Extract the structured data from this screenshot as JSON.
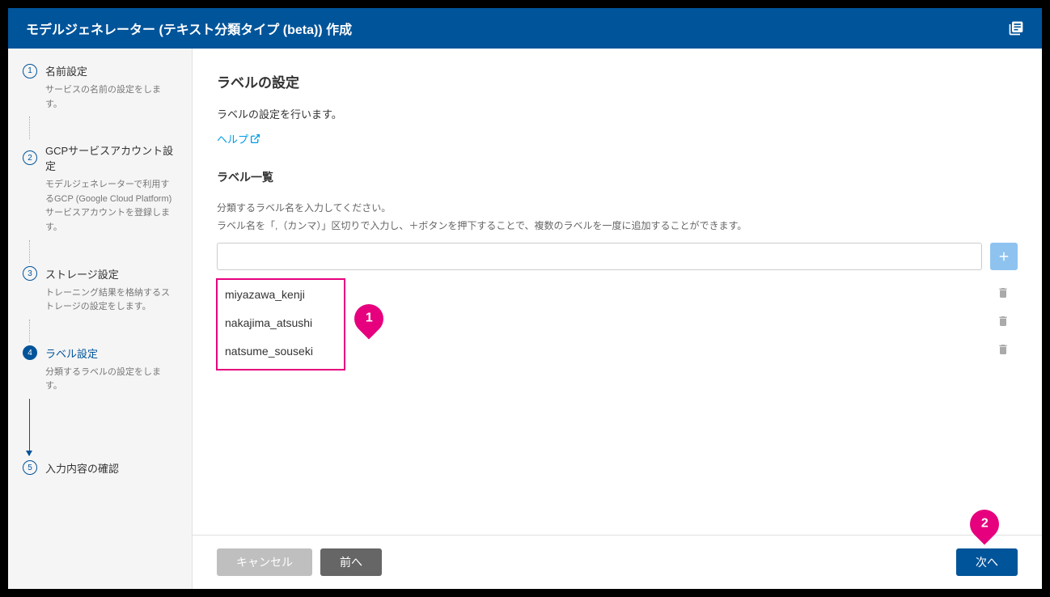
{
  "header": {
    "title": "モデルジェネレーター (テキスト分類タイプ (beta)) 作成"
  },
  "sidebar": {
    "steps": [
      {
        "num": "1",
        "title": "名前設定",
        "desc": "サービスの名前の設定をします。"
      },
      {
        "num": "2",
        "title": "GCPサービスアカウント設定",
        "desc": "モデルジェネレーターで利用するGCP (Google Cloud Platform) サービスアカウントを登録します。"
      },
      {
        "num": "3",
        "title": "ストレージ設定",
        "desc": "トレーニング結果を格納するストレージの設定をします。"
      },
      {
        "num": "4",
        "title": "ラベル設定",
        "desc": "分類するラベルの設定をします。"
      },
      {
        "num": "5",
        "title": "入力内容の確認",
        "desc": ""
      }
    ]
  },
  "main": {
    "page_title": "ラベルの設定",
    "page_desc": "ラベルの設定を行います。",
    "help_link": "ヘルプ",
    "section_title": "ラベル一覧",
    "hint1": "分類するラベル名を入力してください。",
    "hint2": "ラベル名を「,（カンマ）」区切りで入力し、＋ボタンを押下することで、複数のラベルを一度に追加することができます。",
    "labels": [
      "miyazawa_kenji",
      "nakajima_atsushi",
      "natsume_souseki"
    ]
  },
  "footer": {
    "cancel": "キャンセル",
    "prev": "前へ",
    "next": "次へ"
  },
  "markers": {
    "m1": "1",
    "m2": "2"
  }
}
